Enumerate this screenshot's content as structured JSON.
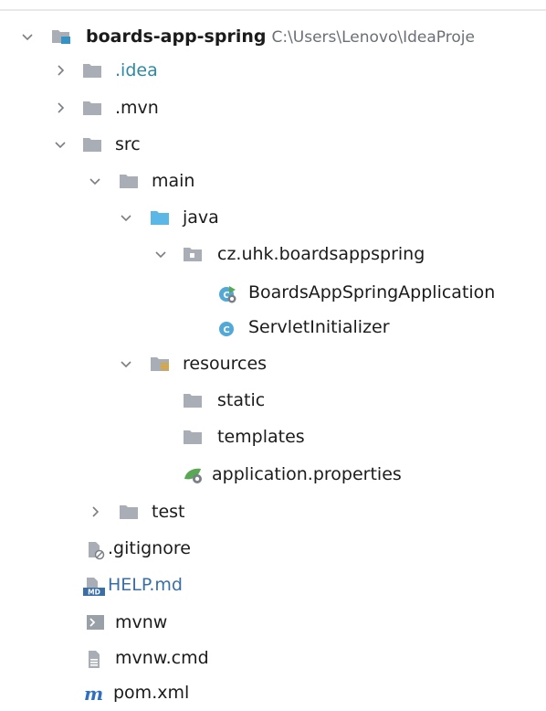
{
  "project": {
    "name": "boards-app-spring",
    "path": "C:\\Users\\Lenovo\\IdeaProje"
  },
  "tree": {
    "idea": ".idea",
    "mvn": ".mvn",
    "src": "src",
    "main": "main",
    "java": "java",
    "package": "cz.uhk.boardsappspring",
    "app_class": "BoardsAppSpringApplication",
    "servlet_class": "ServletInitializer",
    "resources": "resources",
    "static": "static",
    "templates": "templates",
    "app_properties": "application.properties",
    "test": "test",
    "gitignore": ".gitignore",
    "help": "HELP.md",
    "mvnw": "mvnw",
    "mvnw_cmd": "mvnw.cmd",
    "pom": "pom.xml"
  },
  "colors": {
    "folder_gray": "#a9aeb6",
    "source_blue": "#5bb8e6",
    "module_blue": "#3592c4",
    "class_circle": "#52a8d6",
    "spring_green": "#5aa755",
    "git_ignored_text": "#2e8aa0",
    "md_text": "#3a6ea8",
    "maven_blue": "#2f6fc0"
  }
}
